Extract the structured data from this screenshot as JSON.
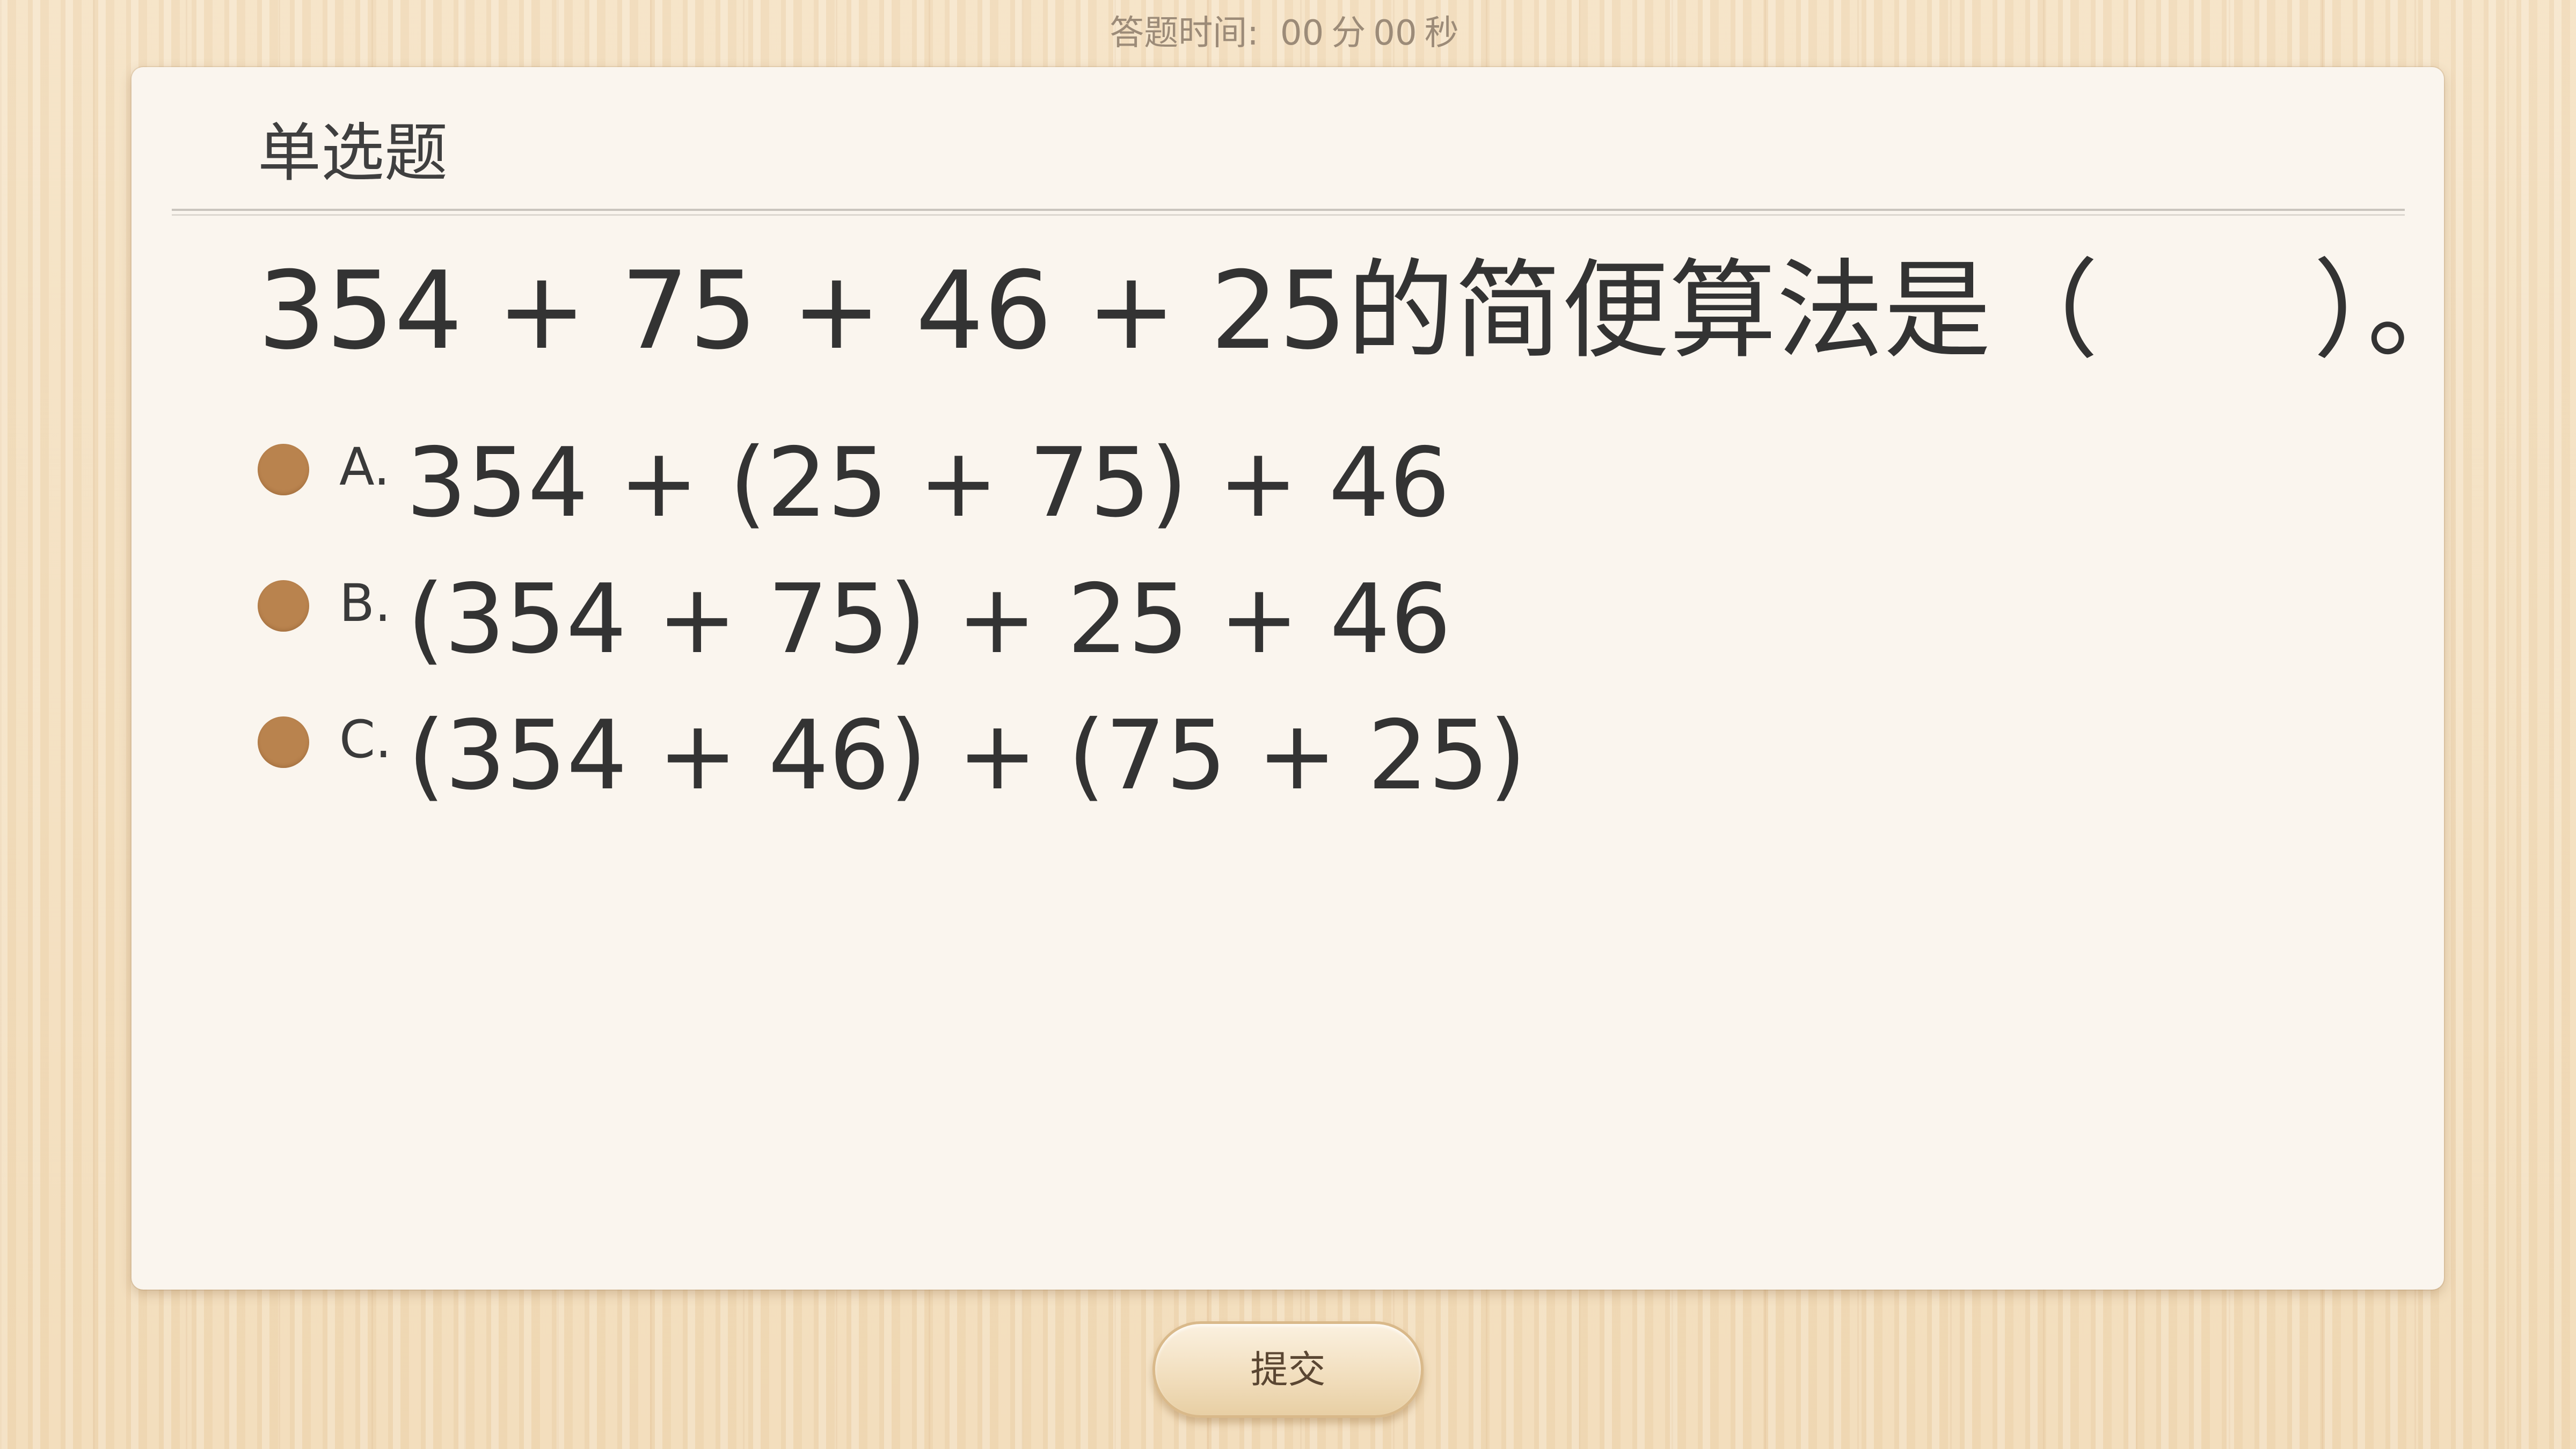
{
  "timer": {
    "label": "答题时间:",
    "minutes": "00",
    "minutes_unit": "分",
    "seconds": "00",
    "seconds_unit": "秒"
  },
  "card": {
    "title": "单选题",
    "question": "354 + 75 + 46 + 25的简便算法是（　　）。",
    "options": [
      {
        "letter": "A.",
        "text": "354 + (25 + 75) + 46"
      },
      {
        "letter": "B.",
        "text": "(354 + 75) + 25 + 46"
      },
      {
        "letter": "C.",
        "text": "(354 + 46) + (75 + 25)"
      }
    ]
  },
  "submit_label": "提交",
  "colors": {
    "radio": "#b9834e",
    "card_background": "#faf5ee",
    "page_background": "#f3dfbf"
  }
}
